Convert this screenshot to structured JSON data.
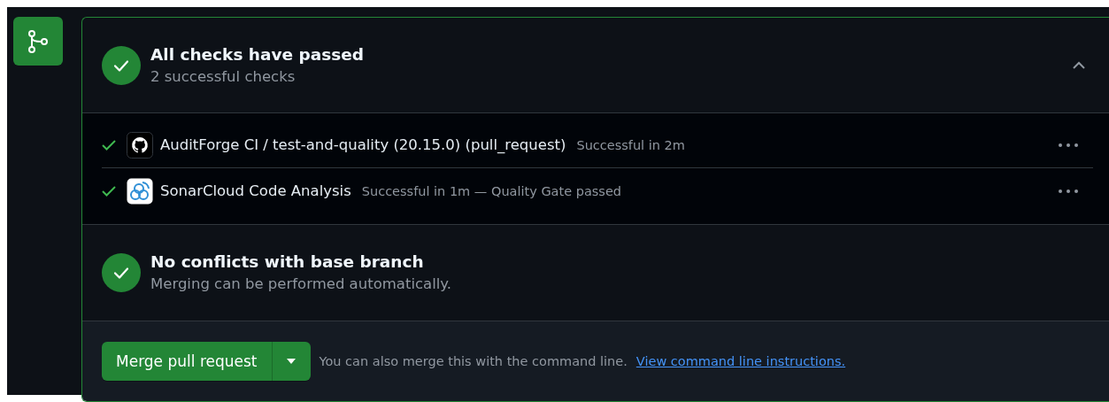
{
  "checks_summary": {
    "title": "All checks have passed",
    "subtitle": "2 successful checks",
    "expanded": true
  },
  "checks": [
    {
      "kind": "github",
      "name": "AuditForge CI / test-and-quality (20.15.0) (pull_request)",
      "status": "Successful in 2m"
    },
    {
      "kind": "sonar",
      "name": "SonarCloud Code Analysis",
      "status": "Successful in 1m — Quality Gate passed"
    }
  ],
  "conflicts": {
    "title": "No conflicts with base branch",
    "subtitle": "Merging can be performed automatically."
  },
  "merge": {
    "button": "Merge pull request",
    "hint": "You can also merge this with the command line.",
    "link": "View command line instructions."
  }
}
